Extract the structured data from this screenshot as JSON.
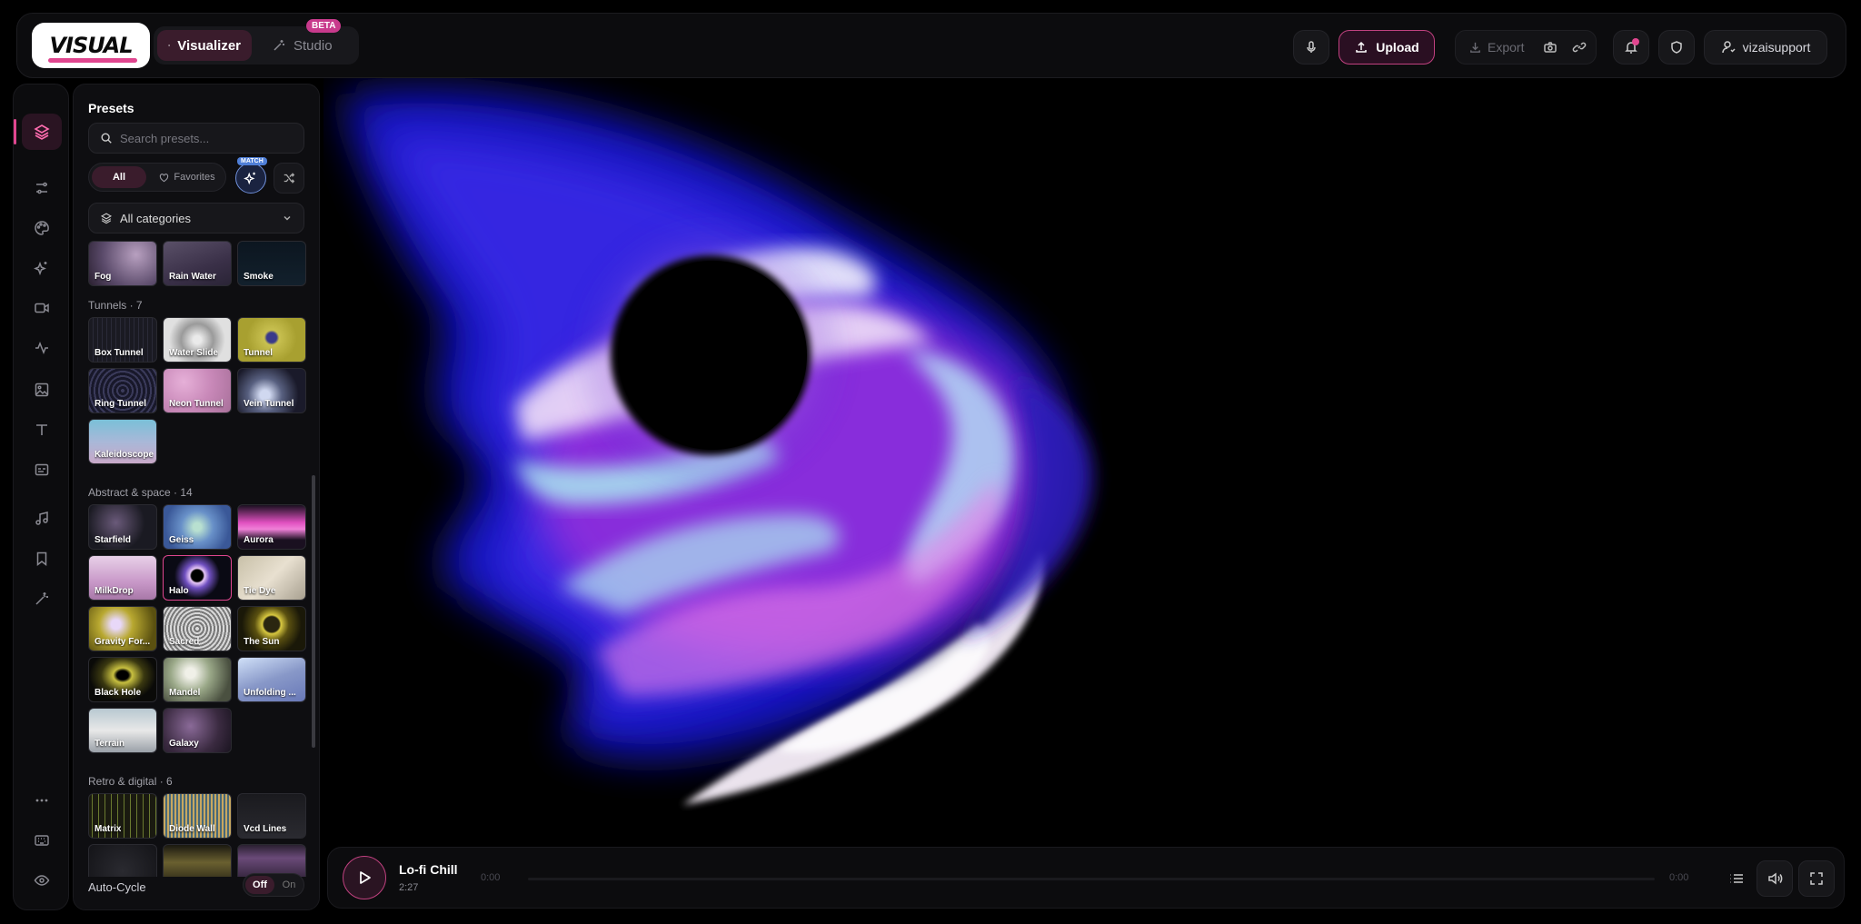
{
  "brand": {
    "logo_text": "VISUAL"
  },
  "modes": {
    "visualizer": "Visualizer",
    "studio": "Studio",
    "beta": "BETA"
  },
  "toolbar": {
    "upload": "Upload",
    "export": "Export",
    "user": "vizaisupport"
  },
  "presets": {
    "title": "Presets",
    "search_placeholder": "Search presets...",
    "filter_all": "All",
    "filter_favorites": "Favorites",
    "match_tag": "MATCH",
    "category": "All categories",
    "sections": [
      {
        "title": "",
        "items": [
          "Fog",
          "Rain Water",
          "Smoke"
        ]
      },
      {
        "title": "Tunnels · 7",
        "items": [
          "Box Tunnel",
          "Water Slide",
          "Tunnel",
          "Ring Tunnel",
          "Neon Tunnel",
          "Vein Tunnel",
          "Kaleidoscope"
        ]
      },
      {
        "title": "Abstract & space · 14",
        "items": [
          "Starfield",
          "Geiss",
          "Aurora",
          "MilkDrop",
          "Halo",
          "Tie Dye",
          "Gravity For...",
          "Sacred",
          "The Sun",
          "Black Hole",
          "Mandel",
          "Unfolding ...",
          "Terrain",
          "Galaxy"
        ]
      },
      {
        "title": "Retro & digital · 6",
        "items": [
          "Matrix",
          "Diode Wall",
          "Vcd Lines"
        ]
      }
    ],
    "selected": "Halo",
    "auto_cycle": {
      "label": "Auto-Cycle",
      "off": "Off",
      "on": "On",
      "state": "off"
    }
  },
  "player": {
    "title": "Lo-fi Chill",
    "duration": "2:27",
    "time_current": "0:00",
    "time_end": "0:00",
    "progress": 0
  },
  "colors": {
    "accent": "#e0468f",
    "accent_dark": "#3a1c2c",
    "match": "#4f7fd8"
  }
}
